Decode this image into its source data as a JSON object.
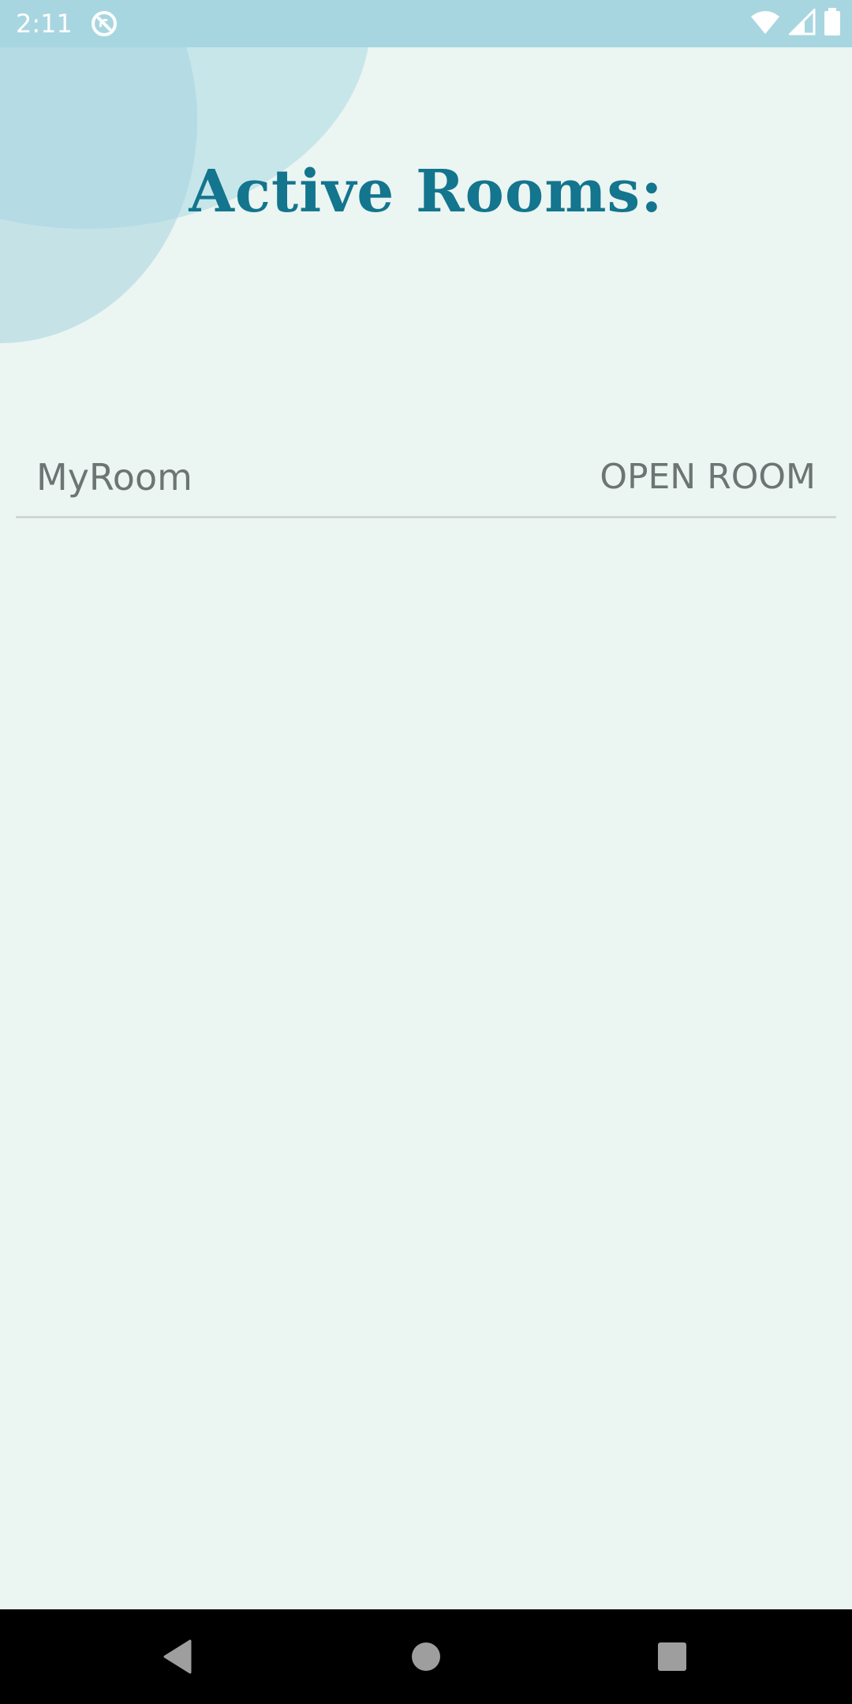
{
  "status_bar": {
    "time": "2:11",
    "app_icon": "sync-icon",
    "icons": [
      "wifi-icon",
      "cell-signal-icon",
      "battery-icon"
    ]
  },
  "colors": {
    "accent": "#13758e",
    "status_bar": "#a8d6e0",
    "background": "#ebf5f2",
    "row_text": "#6c7573"
  },
  "page": {
    "title": "Active Rooms:"
  },
  "rooms": [
    {
      "name": "MyRoom",
      "action_label": "OPEN ROOM"
    }
  ],
  "nav_bar": {
    "icons": [
      "back-icon",
      "home-icon",
      "recents-icon"
    ]
  }
}
